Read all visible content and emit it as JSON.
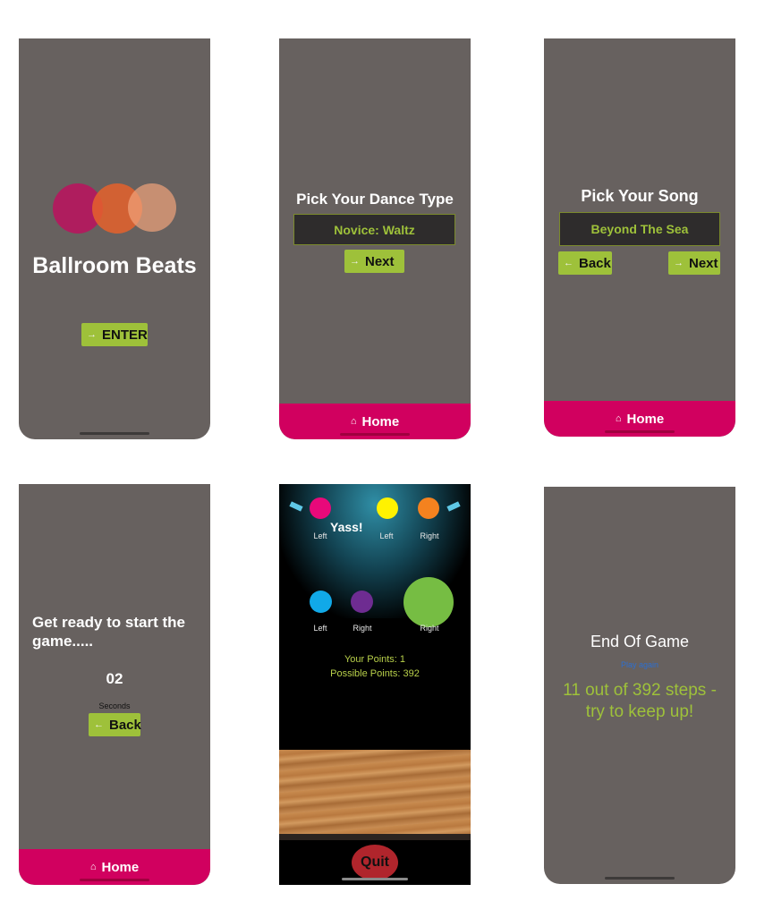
{
  "screen1": {
    "app_name": "Ballroom Beats",
    "enter_label": "ENTER"
  },
  "screen2": {
    "title": "Pick Your Dance Type",
    "selected": "Novice: Waltz",
    "next_label": "Next",
    "home_label": "Home"
  },
  "screen3": {
    "title": "Pick Your Song",
    "selected": "Beyond The Sea",
    "back_label": "Back",
    "next_label": "Next",
    "home_label": "Home"
  },
  "screen4": {
    "message": "Get ready to start the game.....",
    "countdown": "02",
    "unit": "Seconds",
    "back_label": "Back",
    "home_label": "Home"
  },
  "screen5": {
    "feedback": "Yass!",
    "targets": [
      {
        "label": "Left",
        "color": "#e8097a"
      },
      {
        "label": "Left",
        "color": "#fff200"
      },
      {
        "label": "Right",
        "color": "#f4821f"
      },
      {
        "label": "Left",
        "color": "#11a9e8"
      },
      {
        "label": "Right",
        "color": "#6e2c91"
      },
      {
        "label": "Right",
        "color": "#76bd43"
      }
    ],
    "points": "Your Points: 1",
    "possible": "Possible Points: 392",
    "quit_label": "Quit"
  },
  "screen6": {
    "title": "End Of Game",
    "subtitle": "Play again",
    "result": "11 out of 392 steps - try to keep up!"
  },
  "colors": {
    "accent_green": "#9ec13a",
    "home_pink": "#d1005f",
    "phone_gray": "#67615f",
    "quit_red": "#b0252c"
  }
}
